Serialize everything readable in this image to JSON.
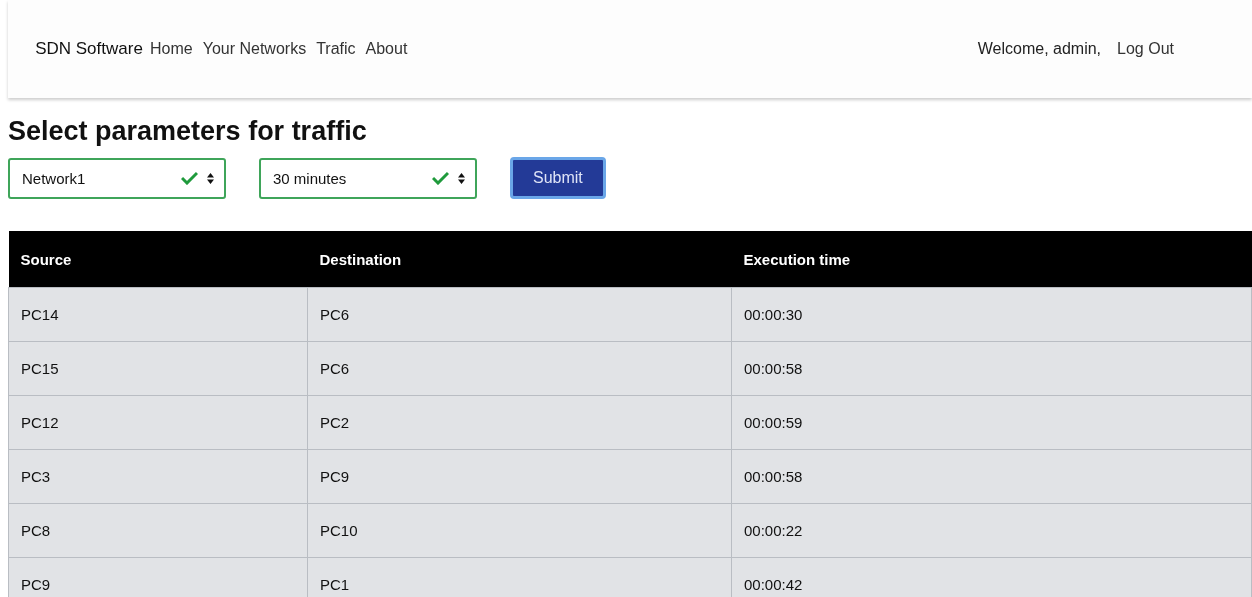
{
  "navbar": {
    "brand": "SDN Software",
    "links": [
      {
        "label": "Home"
      },
      {
        "label": "Your Networks"
      },
      {
        "label": "Trafic"
      },
      {
        "label": "About"
      }
    ],
    "welcome": "Welcome, admin,",
    "logout": "Log Out"
  },
  "heading": "Select parameters for traffic",
  "form": {
    "selects": [
      {
        "value": "Network1",
        "valid": true
      },
      {
        "value": "30 minutes",
        "valid": true
      }
    ],
    "submit": "Submit"
  },
  "table": {
    "columns": [
      "Source",
      "Destination",
      "Execution time"
    ],
    "rows": [
      [
        "PC14",
        "PC6",
        "00:00:30"
      ],
      [
        "PC15",
        "PC6",
        "00:00:58"
      ],
      [
        "PC12",
        "PC2",
        "00:00:59"
      ],
      [
        "PC3",
        "PC9",
        "00:00:58"
      ],
      [
        "PC8",
        "PC10",
        "00:00:22"
      ],
      [
        "PC9",
        "PC1",
        "00:00:42"
      ]
    ]
  }
}
